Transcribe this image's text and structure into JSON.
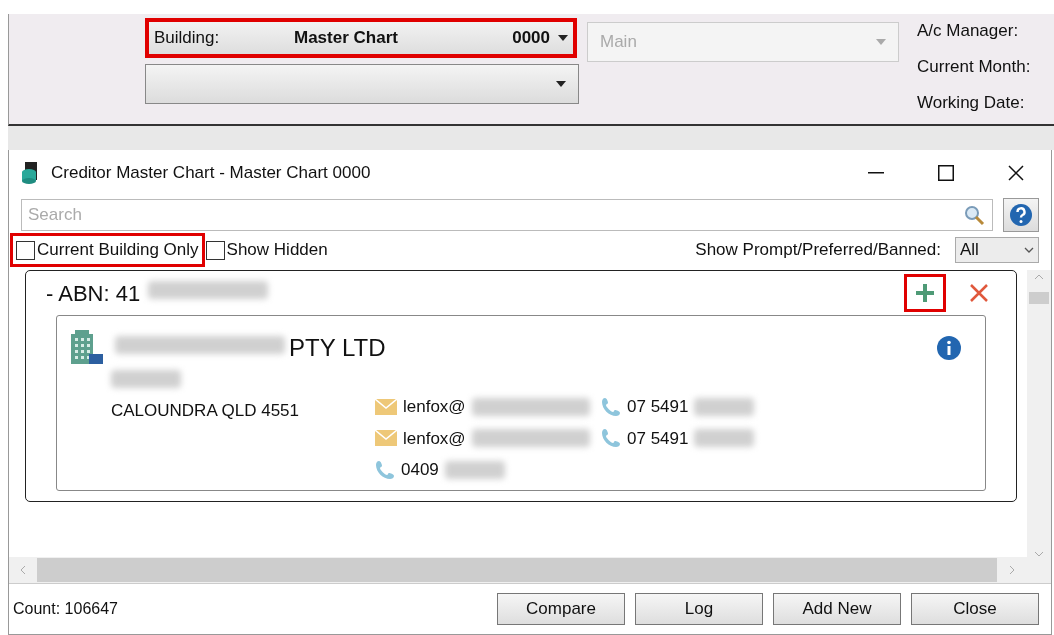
{
  "header": {
    "building": {
      "label": "Building:",
      "name": "Master Chart",
      "code": "0000",
      "highlighted": true
    },
    "second_select": {
      "highlighted": false
    },
    "main_select": {
      "value": "Main",
      "disabled": true
    },
    "info_labels": [
      "A/c Manager:",
      "Current Month:",
      "Working Date:"
    ]
  },
  "window": {
    "title": "Creditor Master Chart - Master Chart 0000"
  },
  "search": {
    "placeholder": "Search"
  },
  "filters": [
    {
      "label": "Current Building Only",
      "checked": false,
      "highlighted": true
    },
    {
      "label": "Show Hidden",
      "checked": false,
      "highlighted": false
    }
  ],
  "prompt_filter": {
    "label": "Show Prompt/Preferred/Banned:",
    "value": "All"
  },
  "group": {
    "heading": "- ABN: 41",
    "add_highlighted": true,
    "creditor": {
      "name_suffix": "PTY LTD",
      "address": "CALOUNDRA  QLD  4551",
      "contacts": [
        {
          "kind": "email",
          "text": "lenfox@"
        },
        {
          "kind": "phone",
          "text": "07 5491"
        },
        {
          "kind": "email",
          "text": "lenfox@"
        },
        {
          "kind": "phone",
          "text": "07 5491"
        },
        {
          "kind": "phone",
          "text": "0409"
        }
      ]
    }
  },
  "status": {
    "count": "Count: 106647"
  },
  "buttons": [
    "Compare",
    "Log",
    "Add New",
    "Close"
  ]
}
